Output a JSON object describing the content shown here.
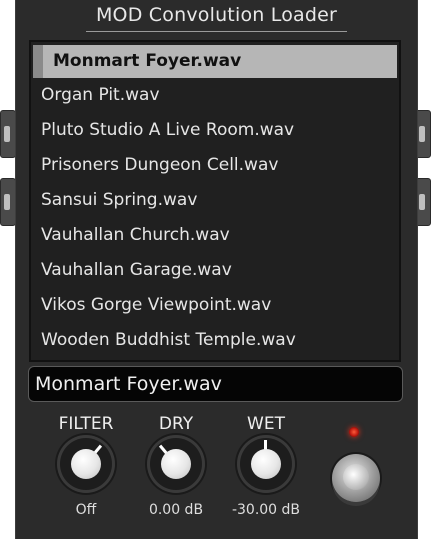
{
  "plugin": {
    "title": "MOD Convolution Loader"
  },
  "file_list": {
    "items": [
      {
        "label": "Monmart Foyer.wav",
        "selected": true
      },
      {
        "label": "Organ Pit.wav",
        "selected": false
      },
      {
        "label": "Pluto Studio A Live Room.wav",
        "selected": false
      },
      {
        "label": "Prisoners Dungeon Cell.wav",
        "selected": false
      },
      {
        "label": "Sansui Spring.wav",
        "selected": false
      },
      {
        "label": "Vauhallan Church.wav",
        "selected": false
      },
      {
        "label": "Vauhallan Garage.wav",
        "selected": false
      },
      {
        "label": "Vikos Gorge Viewpoint.wav",
        "selected": false
      },
      {
        "label": "Wooden Buddhist Temple.wav",
        "selected": false
      }
    ]
  },
  "current_file": "Monmart Foyer.wav",
  "knobs": [
    {
      "label": "FILTER",
      "value": "Off",
      "angle": 40
    },
    {
      "label": "DRY",
      "value": "0.00 dB",
      "angle": -40
    },
    {
      "label": "WET",
      "value": "-30.00 dB",
      "angle": 0
    }
  ],
  "colors": {
    "led": "#e0301c",
    "panel": "#2b2b2b",
    "selected_row": "#b6b6b6"
  }
}
